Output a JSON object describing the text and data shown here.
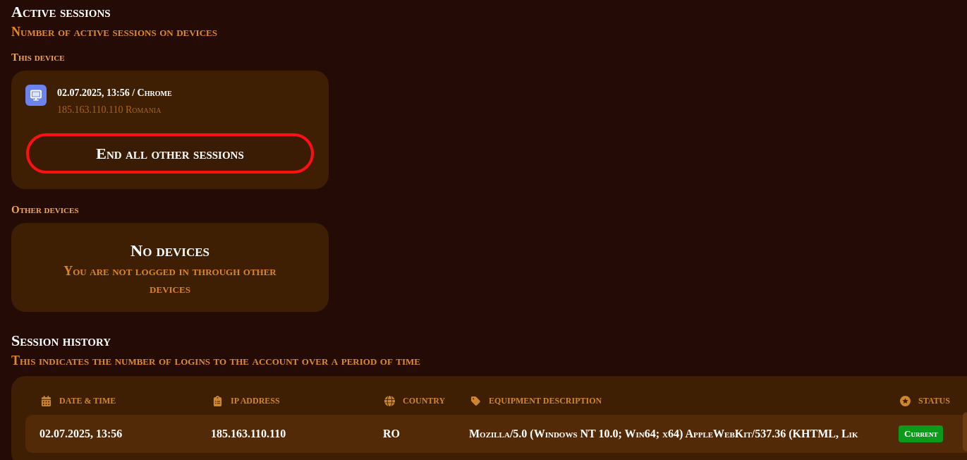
{
  "active_sessions": {
    "title": "Active sessions",
    "subtitle": "Number of active sessions on devices"
  },
  "this_device": {
    "label": "This device",
    "session": {
      "title": "02.07.2025, 13:56 / Chrome",
      "details": "185.163.110.110 Romania"
    },
    "end_button": "End all other sessions"
  },
  "other_devices": {
    "label": "Other devices",
    "empty_title": "No devices",
    "empty_message": "You are not logged in through other devices"
  },
  "session_history": {
    "title": "Session history",
    "subtitle": "This indicates the number of logins to the account over a period of time",
    "table": {
      "columns": [
        "DATE & TIME",
        "IP ADDRESS",
        "COUNTRY",
        "EQUIPMENT DESCRIPTION",
        "STATUS"
      ],
      "rows": [
        {
          "cells": [
            "02.07.2025, 13:56",
            "185.163.110.110",
            "RO",
            "Mozilla/5.0 (Windows NT 10.0; Win64; x64) AppleWebKit/537.36 (KHTML, Lik"
          ],
          "status": "Current"
        }
      ]
    }
  }
}
